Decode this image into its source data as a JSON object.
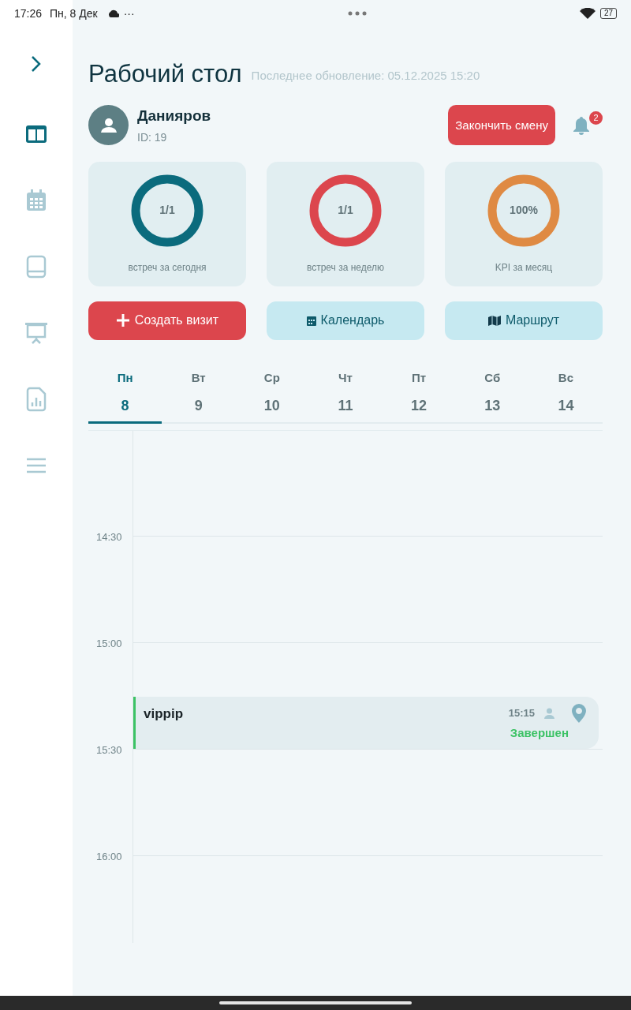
{
  "status_bar": {
    "time": "17:26",
    "date": "Пн, 8 Дек",
    "more": "···",
    "battery": "27"
  },
  "sidebar": {
    "items": [
      {
        "kind": "dashboard",
        "selected": true
      },
      {
        "kind": "calendar",
        "selected": false
      },
      {
        "kind": "book",
        "selected": false
      },
      {
        "kind": "presentation",
        "selected": false
      },
      {
        "kind": "report",
        "selected": false
      },
      {
        "kind": "menu",
        "selected": false
      }
    ]
  },
  "header": {
    "title": "Рабочий стол",
    "updated": "Последнее обновление: 05.12.2025 15:20"
  },
  "user": {
    "name": "Данияров",
    "id": "ID: 19"
  },
  "end_shift_button": "Закончить смену",
  "notifications": {
    "count": "2"
  },
  "stats": [
    {
      "value": "1/1",
      "label": "встреч за сегодня",
      "color": "#0b6b7d"
    },
    {
      "value": "1/1",
      "label": "встреч за неделю",
      "color": "#dc464d"
    },
    {
      "value": "100%",
      "label": "KPI за месяц",
      "color": "#df8a43"
    }
  ],
  "actions": [
    {
      "kind": "create",
      "label": "Создать визит"
    },
    {
      "kind": "calendar",
      "label": "Календарь"
    },
    {
      "kind": "route",
      "label": "Маршрут"
    }
  ],
  "days": [
    {
      "weekday": "Пн",
      "date": "8",
      "selected": true
    },
    {
      "weekday": "Вт",
      "date": "9",
      "selected": false
    },
    {
      "weekday": "Ср",
      "date": "10",
      "selected": false
    },
    {
      "weekday": "Чт",
      "date": "11",
      "selected": false
    },
    {
      "weekday": "Пт",
      "date": "12",
      "selected": false
    },
    {
      "weekday": "Сб",
      "date": "13",
      "selected": false
    },
    {
      "weekday": "Вс",
      "date": "14",
      "selected": false
    }
  ],
  "timeline": {
    "slots": [
      {
        "time": "14:30"
      },
      {
        "time": "15:00",
        "events": [
          {
            "title": "vippip",
            "time": "15:15",
            "status": "Завершен",
            "color": "#3cc265"
          }
        ]
      },
      {
        "time": "15:30"
      },
      {
        "time": "16:00"
      }
    ]
  }
}
